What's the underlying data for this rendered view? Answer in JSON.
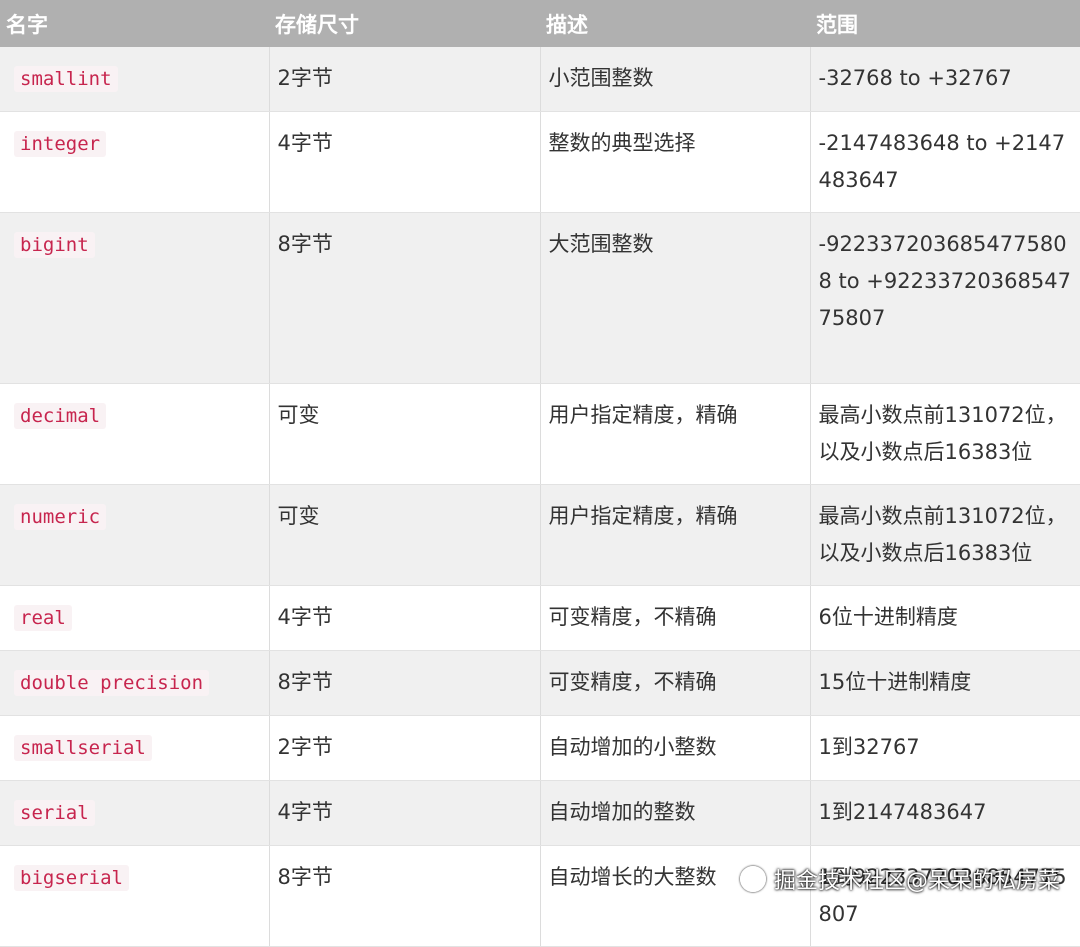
{
  "headers": [
    "名字",
    "存储尺寸",
    "描述",
    "范围"
  ],
  "rows": [
    {
      "name": "smallint",
      "size": "2字节",
      "desc": "小范围整数",
      "range": "-32768 to +32767"
    },
    {
      "name": "integer",
      "size": "4字节",
      "desc": "整数的典型选择",
      "range": "-2147483648 to +2147483647"
    },
    {
      "name": "bigint",
      "size": "8字节",
      "desc": "大范围整数",
      "range": "-9223372036854775808 to +9223372036854775807"
    },
    {
      "name": "decimal",
      "size": "可变",
      "desc": "用户指定精度，精确",
      "range": "最高小数点前131072位，以及小数点后16383位"
    },
    {
      "name": "numeric",
      "size": "可变",
      "desc": "用户指定精度，精确",
      "range": "最高小数点前131072位，以及小数点后16383位"
    },
    {
      "name": "real",
      "size": "4字节",
      "desc": "可变精度，不精确",
      "range": "6位十进制精度"
    },
    {
      "name": "double precision",
      "size": "8字节",
      "desc": "可变精度，不精确",
      "range": "15位十进制精度"
    },
    {
      "name": "smallserial",
      "size": "2字节",
      "desc": "自动增加的小整数",
      "range": "1到32767"
    },
    {
      "name": "serial",
      "size": "4字节",
      "desc": "自动增加的整数",
      "range": "1到2147483647"
    },
    {
      "name": "bigserial",
      "size": "8字节",
      "desc": "自动增长的大整数",
      "range": "1到9223372036854775807"
    }
  ],
  "watermark": "掘金技术社区@呆呆的私房菜",
  "watermark_icon": "wechat-icon"
}
